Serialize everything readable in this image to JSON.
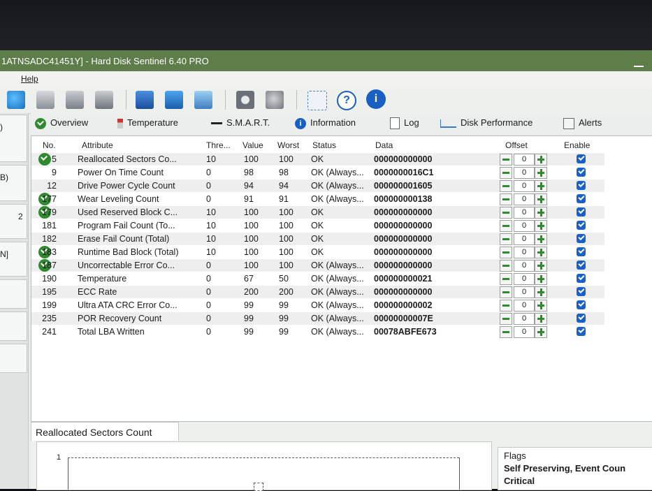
{
  "window": {
    "title": "1ATNSADC41451Y] - Hard Disk Sentinel 6.40 PRO"
  },
  "menu": {
    "help": "Help"
  },
  "left_pane": {
    "items": [
      ")",
      "B)",
      "2",
      "N]"
    ]
  },
  "tabs": [
    {
      "label": "Overview",
      "icon": "green-check-icon"
    },
    {
      "label": "Temperature",
      "icon": "thermometer-icon"
    },
    {
      "label": "S.M.A.R.T.",
      "icon": "smart-dash-icon"
    },
    {
      "label": "Information",
      "icon": "info-icon"
    },
    {
      "label": "Log",
      "icon": "document-icon"
    },
    {
      "label": "Disk Performance",
      "icon": "performance-graph-icon"
    },
    {
      "label": "Alerts",
      "icon": "alerts-icon"
    }
  ],
  "columns": {
    "no": "No.",
    "attribute": "Attribute",
    "threshold": "Thre...",
    "value": "Value",
    "worst": "Worst",
    "status": "Status",
    "data": "Data",
    "offset": "Offset",
    "enable": "Enable"
  },
  "rows": [
    {
      "no": "5",
      "attribute": "Reallocated Sectors Co...",
      "threshold": "10",
      "value": "100",
      "worst": "100",
      "status": "OK",
      "data": "000000000000",
      "offset": "0",
      "check": true
    },
    {
      "no": "9",
      "attribute": "Power On Time Count",
      "threshold": "0",
      "value": "98",
      "worst": "98",
      "status": "OK (Always...",
      "data": "0000000016C1",
      "offset": "0",
      "check": false
    },
    {
      "no": "12",
      "attribute": "Drive Power Cycle Count",
      "threshold": "0",
      "value": "94",
      "worst": "94",
      "status": "OK (Always...",
      "data": "000000001605",
      "offset": "0",
      "check": false
    },
    {
      "no": "177",
      "attribute": "Wear Leveling Count",
      "threshold": "0",
      "value": "91",
      "worst": "91",
      "status": "OK (Always...",
      "data": "000000000138",
      "offset": "0",
      "check": true
    },
    {
      "no": "179",
      "attribute": "Used Reserved Block C...",
      "threshold": "10",
      "value": "100",
      "worst": "100",
      "status": "OK",
      "data": "000000000000",
      "offset": "0",
      "check": true
    },
    {
      "no": "181",
      "attribute": "Program Fail Count (To...",
      "threshold": "10",
      "value": "100",
      "worst": "100",
      "status": "OK",
      "data": "000000000000",
      "offset": "0",
      "check": false
    },
    {
      "no": "182",
      "attribute": "Erase Fail Count (Total)",
      "threshold": "10",
      "value": "100",
      "worst": "100",
      "status": "OK",
      "data": "000000000000",
      "offset": "0",
      "check": false
    },
    {
      "no": "183",
      "attribute": "Runtime Bad Block (Total)",
      "threshold": "10",
      "value": "100",
      "worst": "100",
      "status": "OK",
      "data": "000000000000",
      "offset": "0",
      "check": true
    },
    {
      "no": "187",
      "attribute": "Uncorrectable Error Co...",
      "threshold": "0",
      "value": "100",
      "worst": "100",
      "status": "OK (Always...",
      "data": "000000000000",
      "offset": "0",
      "check": true
    },
    {
      "no": "190",
      "attribute": "Temperature",
      "threshold": "0",
      "value": "67",
      "worst": "50",
      "status": "OK (Always...",
      "data": "000000000021",
      "offset": "0",
      "check": false
    },
    {
      "no": "195",
      "attribute": "ECC Rate",
      "threshold": "0",
      "value": "200",
      "worst": "200",
      "status": "OK (Always...",
      "data": "000000000000",
      "offset": "0",
      "check": false
    },
    {
      "no": "199",
      "attribute": "Ultra ATA CRC Error Co...",
      "threshold": "0",
      "value": "99",
      "worst": "99",
      "status": "OK (Always...",
      "data": "000000000002",
      "offset": "0",
      "check": false
    },
    {
      "no": "235",
      "attribute": "POR Recovery Count",
      "threshold": "0",
      "value": "99",
      "worst": "99",
      "status": "OK (Always...",
      "data": "00000000007E",
      "offset": "0",
      "check": false
    },
    {
      "no": "241",
      "attribute": "Total LBA Written",
      "threshold": "0",
      "value": "99",
      "worst": "99",
      "status": "OK (Always...",
      "data": "00078ABFE673",
      "offset": "0",
      "check": false
    }
  ],
  "bottom": {
    "tab_label": "Reallocated Sectors Count",
    "chart_y_tick": "1",
    "flags_title": "Flags",
    "flags_line1": "Self Preserving, Event Coun",
    "flags_line2": "Critical"
  },
  "colors": {
    "titlebar": "#5e7d4a",
    "ok_green": "#2f8a2f",
    "enable_blue": "#1960c8"
  }
}
